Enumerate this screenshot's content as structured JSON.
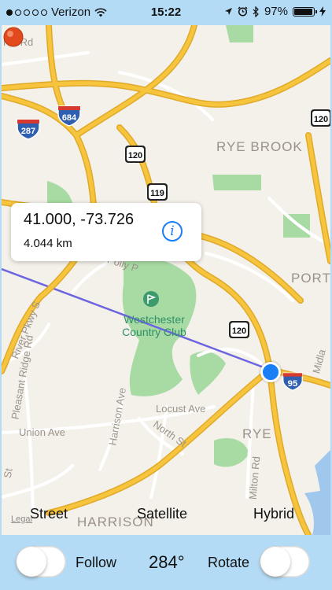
{
  "status_bar": {
    "carrier": "Verizon",
    "time": "15:22",
    "battery_percent": "97%",
    "battery_level": 0.97,
    "signal_bars": 1,
    "icons": [
      "wifi-icon",
      "location-arrow-icon",
      "alarm-icon",
      "bluetooth-icon",
      "battery-icon",
      "charging-icon"
    ]
  },
  "map": {
    "place_labels": [
      "RYE BROOK",
      "PORT",
      "RYE",
      "HARRISON"
    ],
    "road_labels": [
      "Hill Rd",
      "Polly P",
      "Locust Ave",
      "North St",
      "Union Ave",
      "Harrison Ave",
      "Milton Rd",
      "Midla",
      "Pleasant Ridge Rd",
      "River Pkwy S",
      "St"
    ],
    "club_label": "Westchester Country Club",
    "shields": {
      "interstate": [
        "287",
        "684",
        "95"
      ],
      "state": [
        "120",
        "119",
        "120",
        "120"
      ]
    },
    "legal": "Legal",
    "colors": {
      "land": "#f4f1ea",
      "park": "#a8dba4",
      "highway": "#f7c53d",
      "route_line": "#6c64e0",
      "water": "#9fc8ec"
    }
  },
  "callout": {
    "coordinates": "41.000, -73.726",
    "distance": "4.044 km",
    "info_glyph": "i"
  },
  "map_types": {
    "street": "Street",
    "satellite": "Satellite",
    "hybrid": "Hybrid"
  },
  "bottom_bar": {
    "follow_label": "Follow",
    "heading": "284°",
    "rotate_label": "Rotate",
    "follow_on": false,
    "rotate_on": false
  }
}
